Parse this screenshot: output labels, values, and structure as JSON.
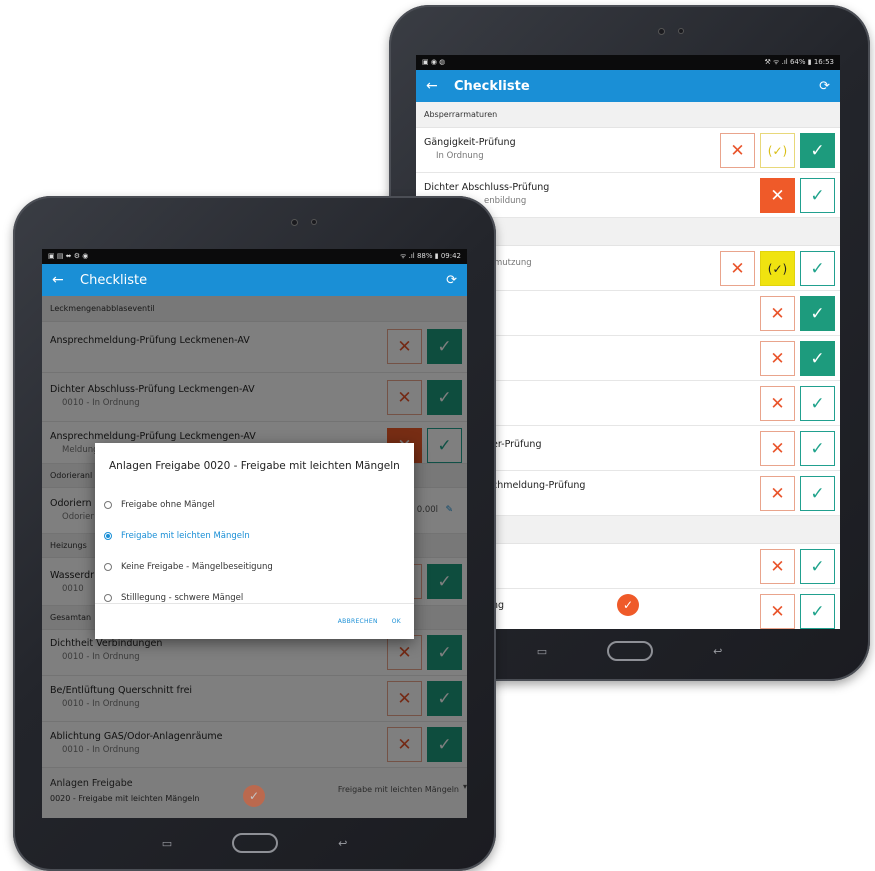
{
  "back_tablet": {
    "status_left": "▣ ◉ ◍",
    "status_right": "⚒ ᯤ .ıl 64% ▮ 16:53",
    "appbar": {
      "title": "Checkliste",
      "back_icon": "←",
      "sync_icon": "⟳"
    },
    "section1": "Absperrarmaturen",
    "rows": [
      {
        "title": "Gängigkeit-Prüfung",
        "sub": "In Ordnung"
      },
      {
        "title": "Dichter Abschluss-Prüfung",
        "sub": "enbildung"
      },
      {
        "title": "",
        "sub": "mutzung"
      },
      {
        "title": "",
        "sub": ""
      },
      {
        "title": "",
        "sub": ""
      },
      {
        "title": "",
        "sub": ""
      },
      {
        "title": "er-Prüfung",
        "sub": ""
      },
      {
        "title": "chmeldung-Prüfung",
        "sub": ""
      },
      {
        "title": "",
        "sub": ""
      },
      {
        "title": "ng",
        "sub": ""
      }
    ],
    "nav": {
      "recent": "▭",
      "back": "↩"
    }
  },
  "front_tablet": {
    "status_left": "▣ ▤ ⬌ ⚙ ◉",
    "status_right": "ᯤ .ıl 88% ▮ 09:42",
    "appbar": {
      "title": "Checkliste",
      "back_icon": "←",
      "sync_icon": "⟳"
    },
    "section1": "Leckmengenabblaseventil",
    "rows": [
      {
        "title": "Ansprechmeldung-Prüfung Leckmenen-AV",
        "sub": ""
      },
      {
        "title": "Dichter Abschluss-Prüfung Leckmengen-AV",
        "sub": "0010 - In Ordnung"
      },
      {
        "title": "Ansprechmeldung-Prüfung Leckmengen-AV",
        "sub": "Meldung"
      }
    ],
    "section2": "Odorieranl",
    "row_odor": {
      "title": "Odoriern",
      "sub": "Odorier",
      "value": "0.00l"
    },
    "section3": "Heizungs",
    "row_wasser": {
      "title": "Wasserdr",
      "sub": "0010"
    },
    "section4": "Gesamtan",
    "rows2": [
      {
        "title": "Dichtheit Verbindungen",
        "sub": "0010 - In Ordnung"
      },
      {
        "title": "Be/Entlüftung Querschnitt frei",
        "sub": "0010 - In Ordnung"
      },
      {
        "title": "Ablichtung GAS/Odor-Anlagenräume",
        "sub": "0010 - In Ordnung"
      }
    ],
    "last_row": {
      "title": "Anlagen Freigabe",
      "sub": "0020 - Freigabe mit leichten Mängeln",
      "value": "Freigabe mit leichten Mängeln"
    },
    "dialog": {
      "title": "Anlagen Freigabe 0020 - Freigabe mit leichten Mängeln",
      "options": [
        "Freigabe ohne Mängel",
        "Freigabe mit leichten Mängeln",
        "Keine Freigabe - Mängelbeseitigung",
        "Stilllegung - schwere Mängel"
      ],
      "selected_index": 1,
      "cancel": "ABBRECHEN",
      "ok": "OK"
    },
    "nav": {
      "recent": "▭",
      "back": "↩"
    }
  },
  "colors": {
    "appbar": "#1a8fd6",
    "reject": "#ef5a29",
    "approve": "#1d9b7d",
    "partial": "#f0e310"
  },
  "glyphs": {
    "x": "✕",
    "check": "✓",
    "check_paren": "(✓)"
  }
}
